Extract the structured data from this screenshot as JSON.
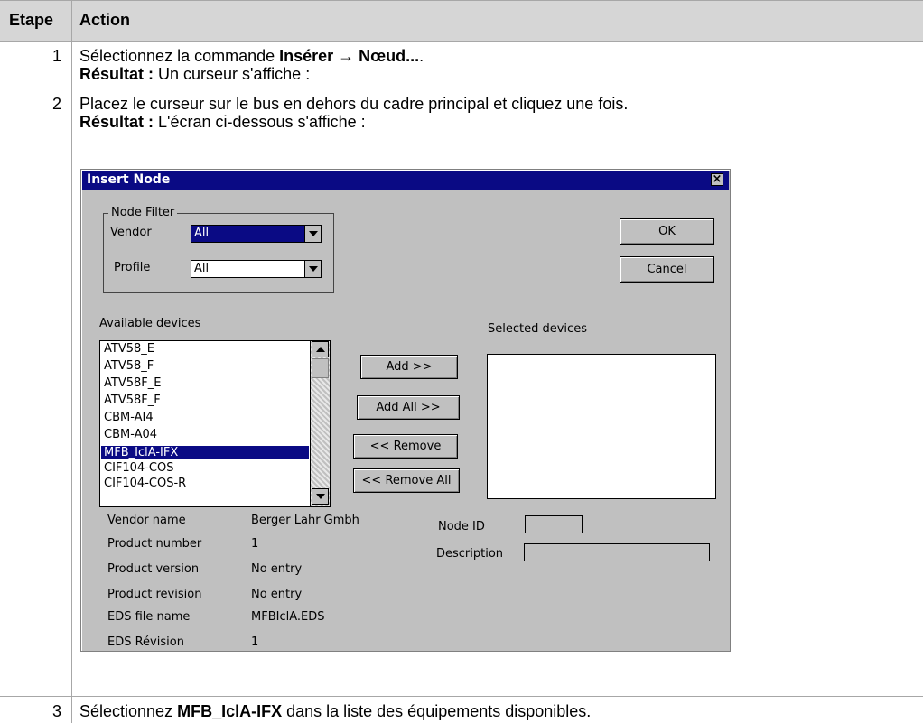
{
  "table": {
    "headers": {
      "step": "Etape",
      "action": "Action"
    },
    "rows": [
      {
        "step": "1",
        "line1_pre": "Sélectionnez la commande ",
        "line1_bold": "Insérer → Nœud...",
        "line1_post": ".",
        "line2_bold": "Résultat :",
        "line2_post": " Un curseur s'affiche :"
      },
      {
        "step": "2",
        "line1": "Placez le curseur sur le bus en dehors du cadre principal et cliquez une fois.",
        "line2_bold": "Résultat :",
        "line2_post": " L'écran ci-dessous s'affiche :"
      },
      {
        "step": "3",
        "line1_pre": "Sélectionnez ",
        "line1_bold": "MFB_IclA-IFX",
        "line1_post": " dans la liste des équipements disponibles."
      }
    ]
  },
  "dialog": {
    "title": "Insert Node",
    "node_filter": {
      "legend": "Node Filter",
      "vendor_label": "Vendor",
      "vendor_value": "All",
      "profile_label": "Profile",
      "profile_value": "All"
    },
    "ok_label": "OK",
    "cancel_label": "Cancel",
    "available_label": "Available devices",
    "selected_label": "Selected devices",
    "available_devices": [
      "ATV58_E",
      "ATV58_F",
      "ATV58F_E",
      "ATV58F_F",
      "CBM-AI4",
      "CBM-A04",
      "MFB_IclA-IFX",
      "CIF104-COS",
      "CIF104-COS-R"
    ],
    "selected_device": "MFB_IclA-IFX",
    "buttons": {
      "add": "Add >>",
      "add_all": "Add All >>",
      "remove": "<< Remove",
      "remove_all": "<< Remove All"
    },
    "info": [
      {
        "label": "Vendor name",
        "value": "Berger Lahr Gmbh"
      },
      {
        "label": "Product number",
        "value": "1"
      },
      {
        "label": "Product version",
        "value": "No entry"
      },
      {
        "label": "Product revision",
        "value": "No entry"
      },
      {
        "label": "EDS file name",
        "value": "MFBIclA.EDS"
      },
      {
        "label": "EDS Révision",
        "value": "1"
      }
    ],
    "node_id_label": "Node ID",
    "node_id_value": "",
    "description_label": "Description",
    "description_value": ""
  },
  "colors": {
    "header_bg": "#d6d6d6",
    "dialog_bg": "#c0c0c0",
    "titlebar": "#0a0a84",
    "selection": "#0a0a84"
  }
}
